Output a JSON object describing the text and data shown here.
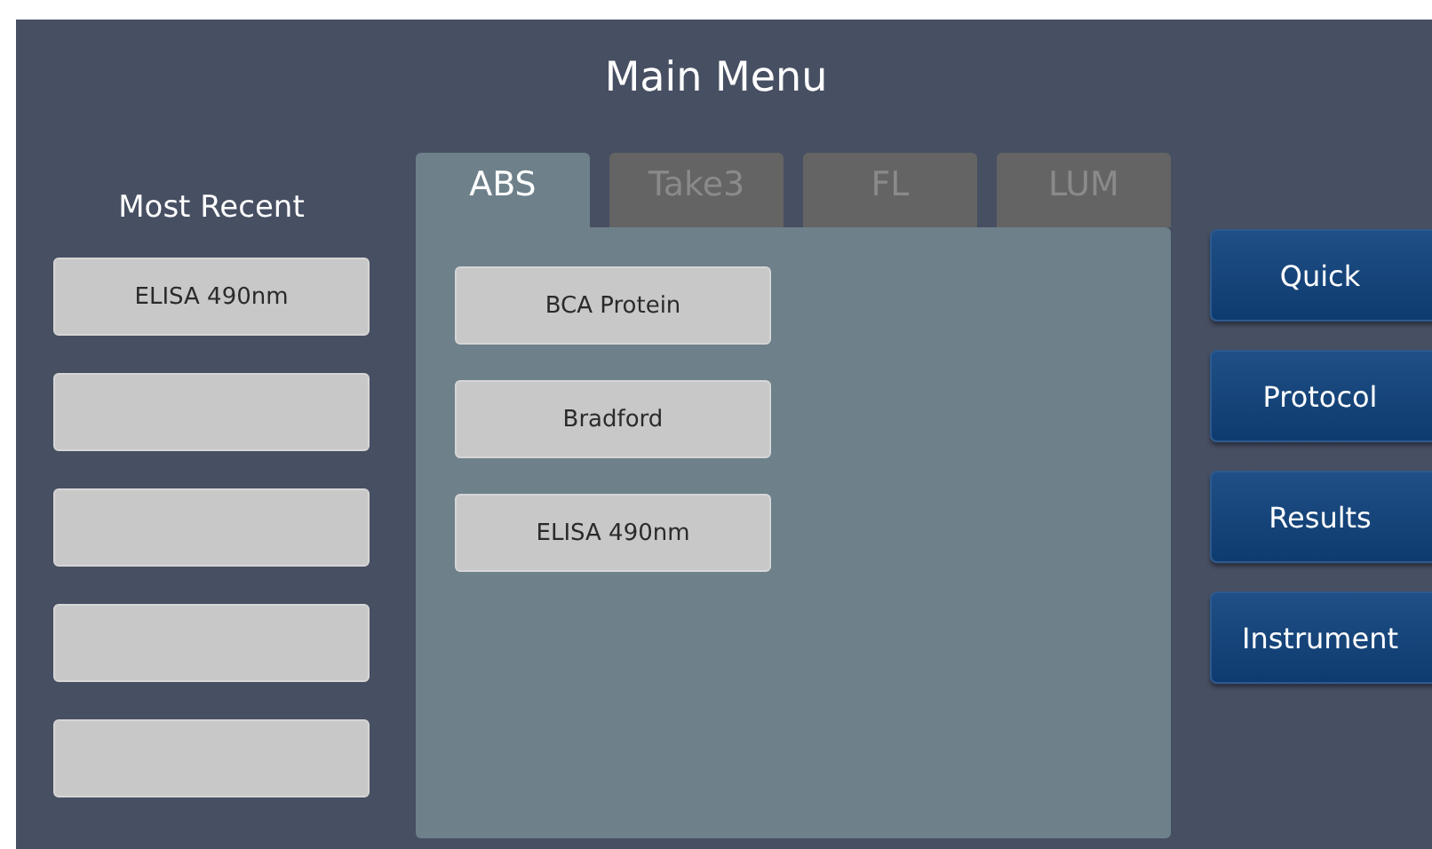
{
  "title": "Main Menu",
  "most_recent": {
    "heading": "Most Recent",
    "slots": [
      {
        "kind": "filled",
        "label": "ELISA 490nm"
      },
      {
        "kind": "empty"
      },
      {
        "kind": "empty"
      },
      {
        "kind": "empty"
      },
      {
        "kind": "empty"
      }
    ]
  },
  "tabs": [
    {
      "label": "ABS",
      "selected": true
    },
    {
      "label": "Take3",
      "selected": false
    },
    {
      "label": "FL",
      "selected": false
    },
    {
      "label": "LUM",
      "selected": false
    }
  ],
  "protocols": [
    "BCA Protein",
    "Bradford",
    "ELISA 490nm"
  ],
  "nav_buttons": [
    "Quick",
    "Protocol",
    "Results",
    "Instrument"
  ]
}
